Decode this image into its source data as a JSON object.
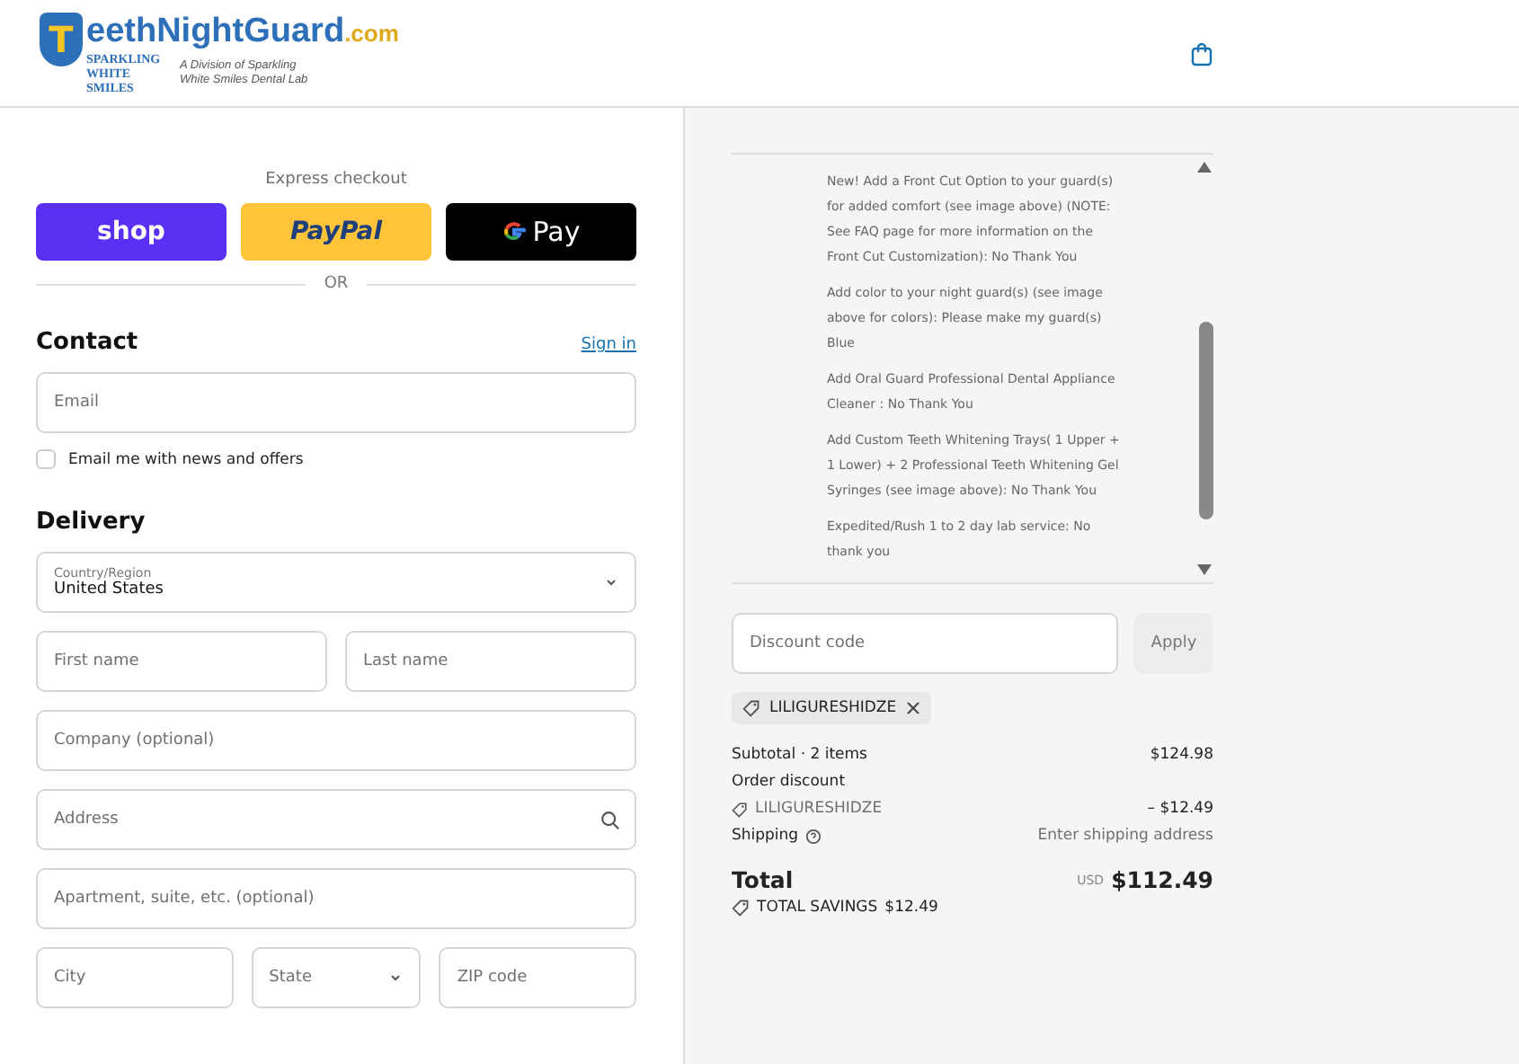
{
  "logo": {
    "letter": "T",
    "name": "eethNightGuard",
    "domain": ".com",
    "brand": "SPARKLING",
    "brand_sub": "WHITE SMILES",
    "tagline": "A Division of Sparkling White Smiles Dental Lab"
  },
  "express": {
    "title": "Express checkout",
    "buttons": [
      {
        "kind": "shop",
        "label": "shop"
      },
      {
        "kind": "paypal",
        "label": "PayPal"
      },
      {
        "kind": "gpay",
        "label": "Pay"
      }
    ],
    "divider": "OR"
  },
  "contact": {
    "title": "Contact",
    "link": "Sign in",
    "email": {
      "placeholder": "Email"
    },
    "newsletter": {
      "label": "Email me with news and offers",
      "checked": false
    }
  },
  "delivery": {
    "title": "Delivery",
    "country": {
      "label": "Country/Region",
      "value": "United States"
    },
    "rows": [
      [
        {
          "kind": "text",
          "placeholder": "First name"
        },
        {
          "kind": "text",
          "placeholder": "Last name"
        }
      ],
      [
        {
          "kind": "text",
          "placeholder": "Company (optional)"
        }
      ],
      [
        {
          "kind": "search",
          "placeholder": "Address"
        }
      ],
      [
        {
          "kind": "text",
          "placeholder": "Apartment, suite, etc. (optional)"
        }
      ],
      [
        {
          "kind": "text",
          "placeholder": "City"
        },
        {
          "kind": "select",
          "placeholder": "State"
        },
        {
          "kind": "text",
          "placeholder": "ZIP code"
        }
      ]
    ]
  },
  "order": {
    "options": [
      "New! Add a Front Cut Option to your guard(s) for added comfort (see image above) (NOTE: See FAQ page for more information on the Front Cut Customization): No Thank You",
      "Add color to your night guard(s) (see image above for colors): Please make my guard(s) Blue",
      "Add Oral Guard Professional Dental Appliance Cleaner : No Thank You",
      "Add Custom Teeth Whitening Trays( 1 Upper + 1 Lower) + 2 Professional Teeth Whitening Gel Syringes (see image above): No Thank You",
      "Expedited/Rush 1 to 2 day lab service: No thank you"
    ],
    "discount": {
      "placeholder": "Discount code",
      "button": "Apply",
      "disabled": true
    },
    "applied_code": "LILIGURESHIDZE",
    "subtotal": {
      "label": "Subtotal · 2 items",
      "value": "$124.98"
    },
    "discount_line": {
      "label": "Order discount",
      "code": "LILIGURESHIDZE",
      "value": "– $12.49"
    },
    "shipping": {
      "label": "Shipping",
      "value": "Enter shipping address"
    },
    "total": {
      "label": "Total",
      "currency": "USD",
      "value": "$112.49"
    },
    "savings": {
      "label": "TOTAL SAVINGS",
      "value": "$12.49"
    }
  }
}
